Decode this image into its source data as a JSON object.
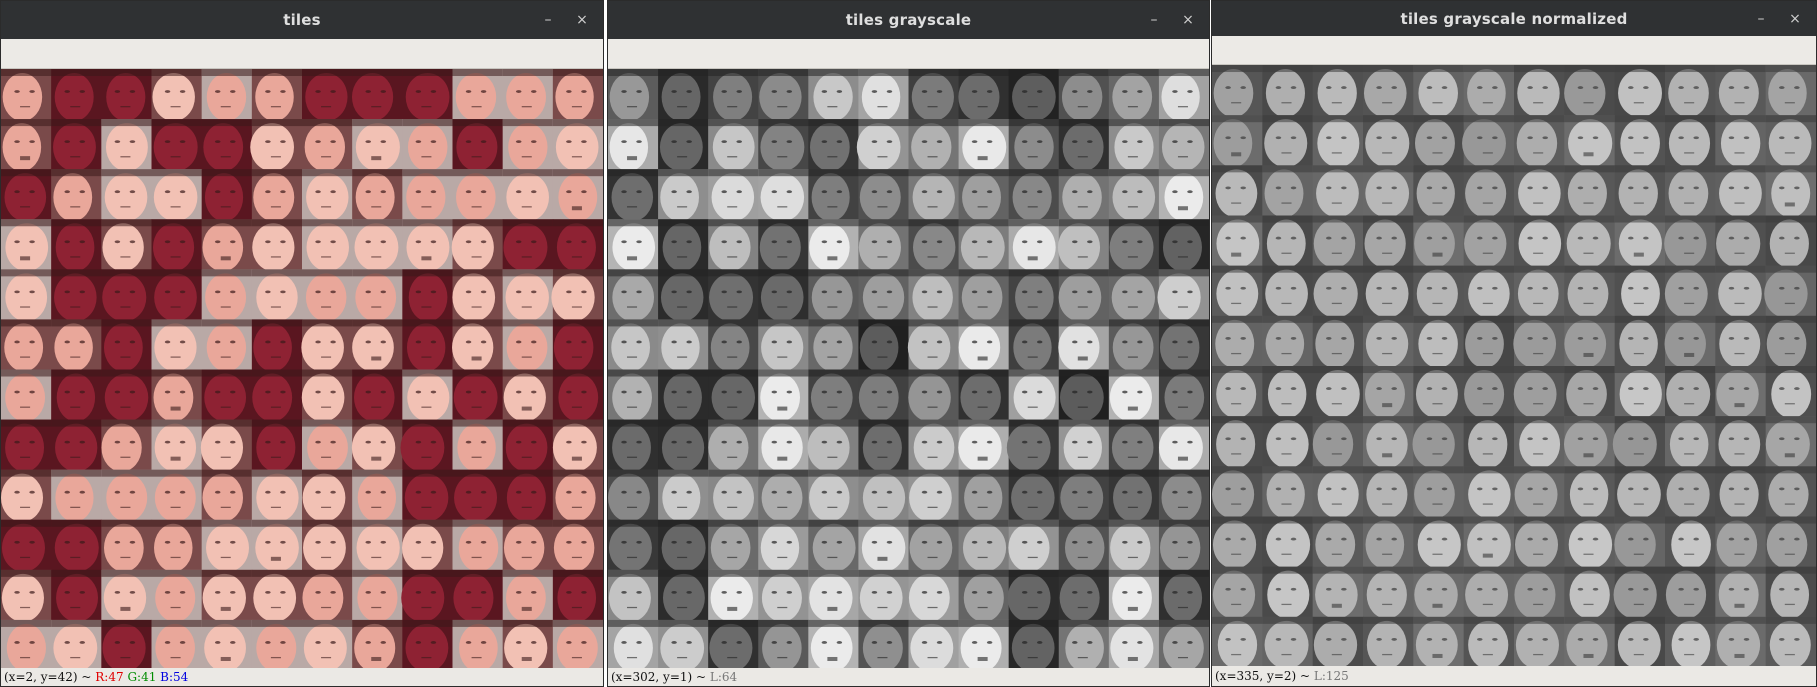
{
  "windows": [
    {
      "title": "tiles",
      "minimize": "–",
      "close": "×",
      "mode": "color",
      "status": {
        "coords": "(x=2, y=42) ~",
        "r": "R:47",
        "g": "G:41",
        "b": "B:54"
      },
      "colors": {
        "r": "#e00000",
        "g": "#008c00",
        "b": "#0000e0"
      }
    },
    {
      "title": "tiles grayscale",
      "minimize": "–",
      "close": "×",
      "mode": "gray",
      "status": {
        "coords": "(x=302, y=1) ~",
        "l": "L:64"
      }
    },
    {
      "title": "tiles grayscale normalized",
      "minimize": "–",
      "close": "×",
      "mode": "norm",
      "status": {
        "coords": "(x=335, y=2) ~",
        "l": "L:125"
      }
    }
  ],
  "grid": {
    "rows": 12,
    "cols": 12
  }
}
